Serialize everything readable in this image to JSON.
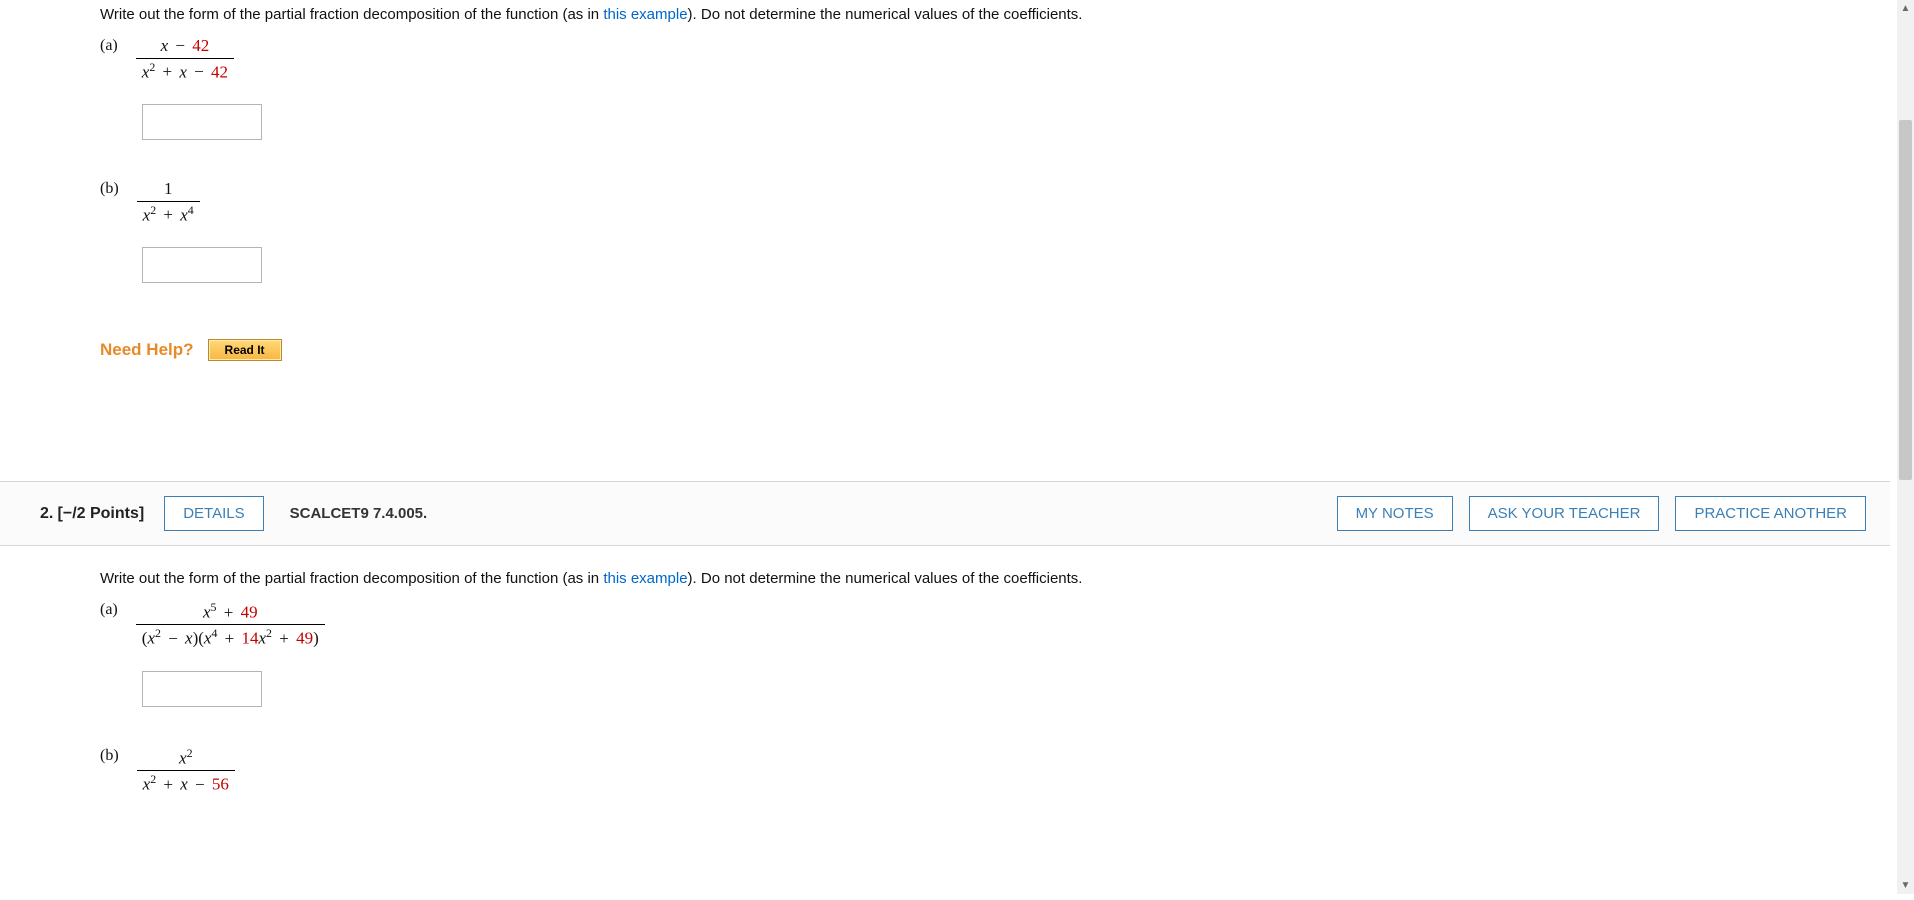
{
  "q1": {
    "instruction_prefix": "Write out the form of the partial fraction decomposition of the function (as in ",
    "example_link": "this example",
    "instruction_suffix": "). Do not determine the numerical values of the coefficients.",
    "part_a": {
      "label": "(a)",
      "num_var": "x",
      "num_op": " − ",
      "num_const": "42",
      "den_prefix": "x",
      "den_sup1": "2",
      "den_op1": " + ",
      "den_mid": "x",
      "den_op2": " − ",
      "den_const": "42"
    },
    "part_b": {
      "label": "(b)",
      "num": "1",
      "den_a": "x",
      "den_sup1": "2",
      "den_op": " + ",
      "den_b": "x",
      "den_sup2": "4"
    },
    "need_help_label": "Need Help?",
    "read_it_label": "Read It"
  },
  "q2": {
    "header": {
      "number": "2.",
      "points": "[−/2 Points]",
      "details_btn": "DETAILS",
      "book_ref": "SCALCET9 7.4.005.",
      "my_notes": "MY NOTES",
      "ask_teacher": "ASK YOUR TEACHER",
      "practice_another": "PRACTICE ANOTHER"
    },
    "instruction_prefix": "Write out the form of the partial fraction decomposition of the function (as in ",
    "example_link": "this example",
    "instruction_suffix": "). Do not determine the numerical values of the coefficients.",
    "part_a": {
      "label": "(a)",
      "num_a": "x",
      "num_sup": "5",
      "num_op": " + ",
      "num_const": "49",
      "den_open": "(",
      "den_x1": "x",
      "den_sup1": "2",
      "den_op1": " − ",
      "den_x2": "x",
      "den_close1": ")(",
      "den_x3": "x",
      "den_sup2": "4",
      "den_op2": " + ",
      "den_coef": "14",
      "den_x4": "x",
      "den_sup3": "2",
      "den_op3": " + ",
      "den_const": "49",
      "den_close2": ")"
    },
    "part_b": {
      "label": "(b)",
      "num_a": "x",
      "num_sup": "2",
      "den_a": "x",
      "den_sup1": "2",
      "den_op1": " + ",
      "den_b": "x",
      "den_op2": " − ",
      "den_const": "56"
    }
  }
}
